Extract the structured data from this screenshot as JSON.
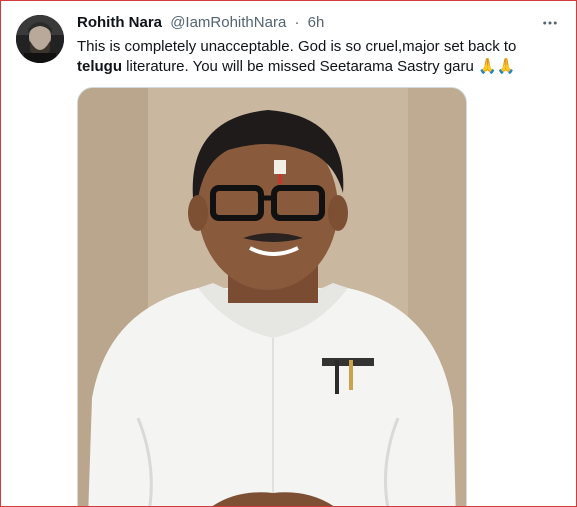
{
  "tweet": {
    "author_name": "Rohith Nara",
    "author_handle": "@IamRohithNara",
    "separator": "·",
    "time": "6h",
    "more_icon": "more-horizontal-icon",
    "text_part1": "This is completely unacceptable. God is so cruel,major set back to ",
    "text_keyword": "telugu",
    "text_part2": " literature. You will be missed Seetarama Sastry garu ",
    "text_emoji": "🙏🙏"
  },
  "colors": {
    "frame_border": "#d33a3a",
    "primary_text": "#0f1419",
    "secondary_text": "#536471"
  }
}
